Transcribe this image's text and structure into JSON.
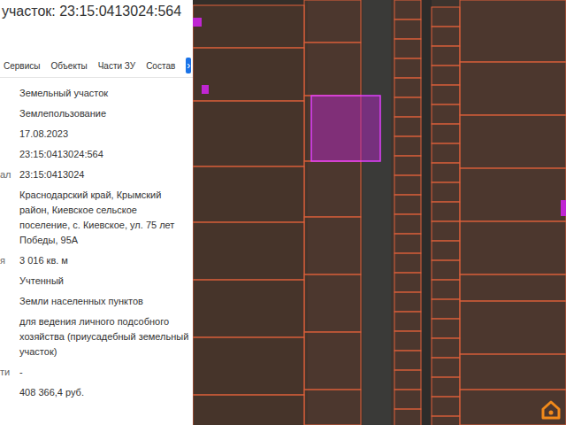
{
  "panel": {
    "title": "участок: 23:15:0413024:564",
    "tabs": [
      {
        "label": "Сервисы",
        "selected": false
      },
      {
        "label": "Объекты",
        "selected": false
      },
      {
        "label": "Части ЗУ",
        "selected": false
      },
      {
        "label": "Состав",
        "selected": false
      }
    ],
    "tabs_next": "›",
    "rows": [
      {
        "label": "",
        "value": "Земельный участок"
      },
      {
        "label": "",
        "value": "Землепользование"
      },
      {
        "label": "",
        "value": "17.08.2023"
      },
      {
        "label": "",
        "value": "23:15:0413024:564"
      },
      {
        "label": "ал",
        "value": "23:15:0413024"
      },
      {
        "label": "",
        "value": "Краснодарский край, Крымский район, Киевское сельское поселение, с. Киевское, ул. 75 лет Победы, 95А"
      },
      {
        "label": "я",
        "value": "3 016 кв. м"
      },
      {
        "label": "",
        "value": "Учтенный"
      },
      {
        "label": "",
        "value": "Земли населенных пунктов"
      },
      {
        "label": "",
        "value": "для ведения личного подсобного хозяйства (приусадебный земельный участок)"
      },
      {
        "label": "ти",
        "value": "-"
      },
      {
        "label": "",
        "value": "408 366,4 руб."
      }
    ]
  },
  "map": {
    "highlighted_parcel": true
  }
}
